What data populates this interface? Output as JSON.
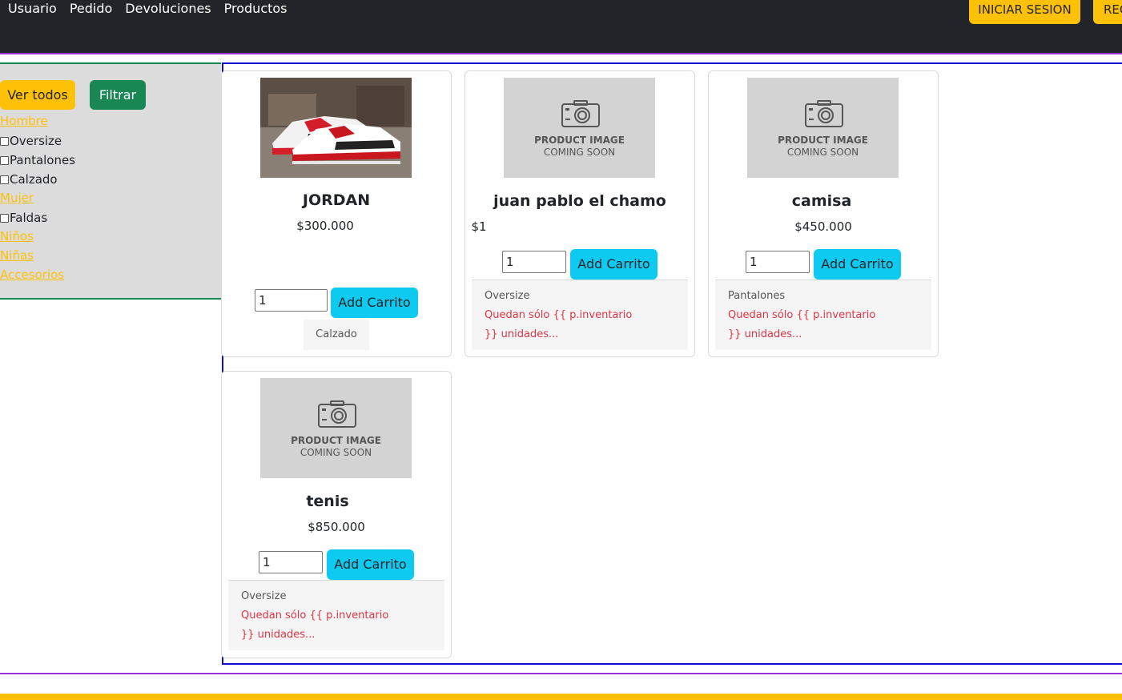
{
  "nav": {
    "links": [
      "Usuario",
      "Pedido",
      "Devoluciones",
      "Productos"
    ],
    "login_label": "INICIAR SESION",
    "register_label": "REGISTRARSE"
  },
  "sidebar": {
    "ver_todos_label": "Ver todos",
    "filtrar_label": "Filtrar",
    "filters": [
      {
        "kind": "link",
        "label": "Hombre"
      },
      {
        "kind": "check",
        "label": "Oversize",
        "checked": false
      },
      {
        "kind": "check",
        "label": "Pantalones",
        "checked": false
      },
      {
        "kind": "check",
        "label": "Calzado",
        "checked": false
      },
      {
        "kind": "link",
        "label": "Mujer"
      },
      {
        "kind": "check",
        "label": "Faldas",
        "checked": false
      },
      {
        "kind": "link",
        "label": "Niños"
      },
      {
        "kind": "link",
        "label": "Niñas"
      },
      {
        "kind": "link",
        "label": "Accesorios"
      }
    ]
  },
  "products": [
    {
      "name": "JORDAN",
      "price": "$300.000",
      "quantity": "1",
      "add_label": "Add Carrito",
      "category": "Calzado",
      "image": "sneaker-photo"
    },
    {
      "name": "juan pablo el chamo",
      "price": "$1",
      "quantity": "1",
      "add_label": "Add Carrito",
      "category": "Oversize",
      "stock_text": "Quedan sólo {{ p.inventario }} unidades...",
      "image_placeholder_title": "PRODUCT IMAGE",
      "image_placeholder_sub": "COMING SOON"
    },
    {
      "name": "camisa",
      "price": "$450.000",
      "quantity": "1",
      "add_label": "Add Carrito",
      "category": "Pantalones",
      "stock_text": "Quedan sólo {{ p.inventario }} unidades...",
      "image_placeholder_title": "PRODUCT IMAGE",
      "image_placeholder_sub": "COMING SOON"
    },
    {
      "name": "tenis",
      "price": "$850.000",
      "quantity": "1",
      "add_label": "Add Carrito",
      "category": "Oversize",
      "stock_text": "Quedan sólo {{ p.inventario }} unidades...",
      "image_placeholder_title": "PRODUCT IMAGE",
      "image_placeholder_sub": "COMING SOON"
    }
  ],
  "colors": {
    "navbar": "#212529",
    "accent_yellow": "#ffc107",
    "filter_green": "#198754",
    "add_cyan": "#0dcaf0",
    "stock_red": "#dc3545"
  }
}
